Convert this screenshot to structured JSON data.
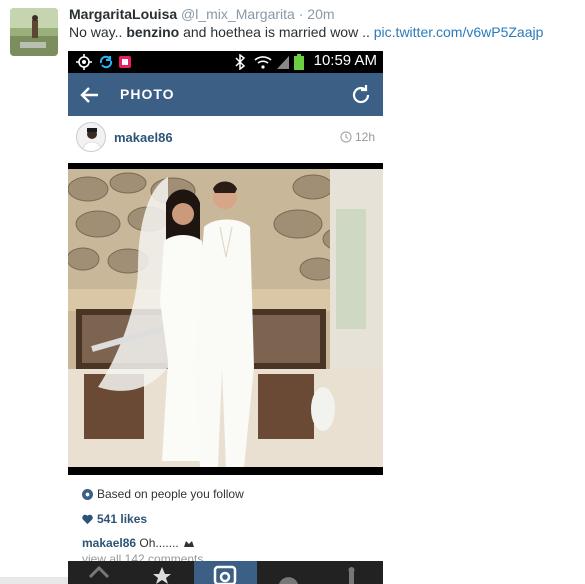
{
  "tweet": {
    "name": "MargaritaLouisa",
    "handle": "@l_mix_Margarita",
    "separator": "·",
    "time": "20m",
    "text_before": "No way..",
    "text_bold": "benzino",
    "text_after": "and hoethea is married wow ..",
    "link": "pic.twitter.com/v6wP5Zaajp"
  },
  "phone": {
    "status_time": "10:59 AM",
    "appbar_title": "PHOTO",
    "post": {
      "username": "makael86",
      "age": "12h",
      "suggestion": "Based on people you follow",
      "likes": "541 likes",
      "comment_user": "makael86",
      "comment_text": "Oh.......",
      "view_all": "view all 142 comments"
    }
  },
  "colors": {
    "twitter_link": "#2b7bb9",
    "instagram_bar": "#3c5f85",
    "instagram_user": "#2d5478"
  },
  "icons": {
    "back": "arrow-left-icon",
    "refresh": "refresh-icon",
    "clock": "clock-icon",
    "suggestion": "people-icon",
    "heart": "heart-icon"
  }
}
